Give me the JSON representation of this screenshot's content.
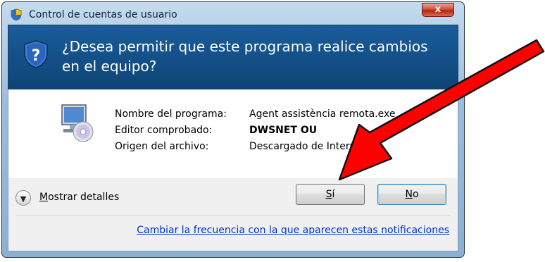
{
  "window": {
    "title": "Control de cuentas de usuario",
    "close_symbol": "x"
  },
  "header": {
    "question": "¿Desea permitir que este programa realice cambios en el equipo?",
    "icon": "uac-shield-icon"
  },
  "program_info": {
    "icon": "computer-disc-icon",
    "rows": [
      {
        "label": "Nombre del programa:",
        "value": "Agent assistència remota.exe"
      },
      {
        "label": "Editor comprobado:",
        "value": "DWSNET OU"
      },
      {
        "label": "Origen del archivo:",
        "value": "Descargado de Internet"
      }
    ]
  },
  "footer": {
    "details_first_letter": "M",
    "details_rest": "ostrar detalles",
    "yes_accel": "S",
    "yes_rest": "í",
    "no_accel": "N",
    "no_rest": "o",
    "notifications_link": "Cambiar la frecuencia con la que aparecen estas notificaciones"
  },
  "colors": {
    "header_bg": "#0f4a80",
    "link": "#0033cc",
    "arrow": "#ff0000"
  }
}
